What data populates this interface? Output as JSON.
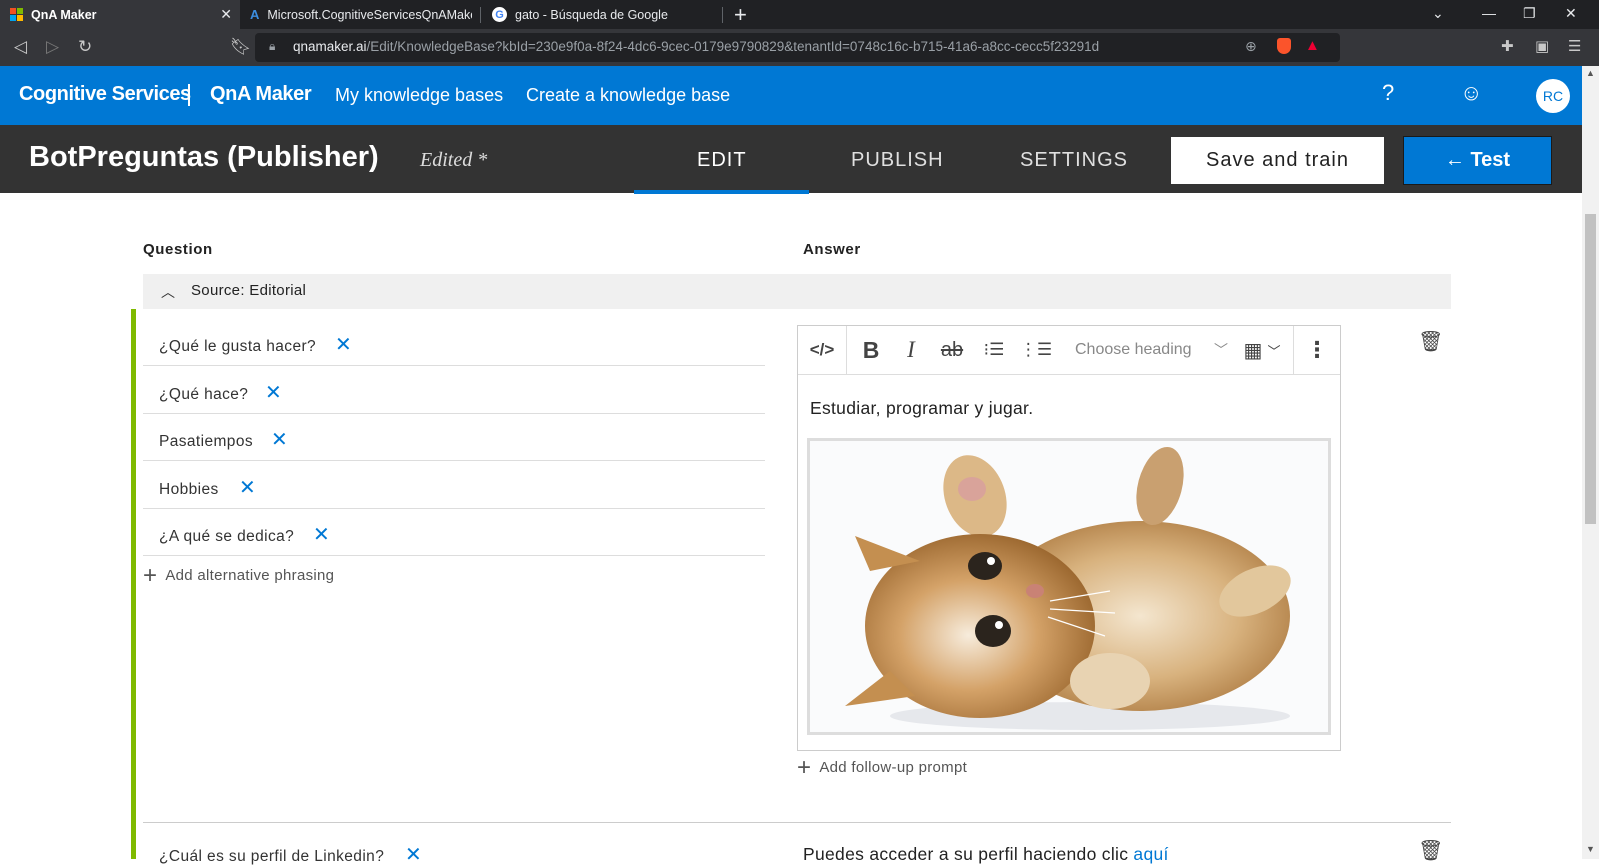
{
  "browser": {
    "tabs": [
      {
        "title": "QnA Maker",
        "active": true
      },
      {
        "title": "Microsoft.CognitiveServicesQnAMaker",
        "active": false
      },
      {
        "title": "gato - Búsqueda de Google",
        "active": false
      }
    ],
    "url_host": "qnamaker.ai",
    "url_path": "/Edit/KnowledgeBase?kbId=230e9f0a-8f24-4dc6-9cec-0179e9790829&tenantId=0748c16c-b715-41a6-a8cc-cecc5f23291d"
  },
  "header": {
    "brand": "Cognitive Services",
    "product": "QnA Maker",
    "nav": [
      "My knowledge bases",
      "Create a knowledge base"
    ],
    "avatar_initials": "RC"
  },
  "kb": {
    "name": "BotPreguntas (Publisher)",
    "status": "Edited *",
    "tabs": [
      "EDIT",
      "PUBLISH",
      "SETTINGS"
    ],
    "active_tab": "EDIT",
    "save_label": "Save and train",
    "test_label": "← Test"
  },
  "columns": {
    "question": "Question",
    "answer": "Answer"
  },
  "source": {
    "label": "Source: Editorial"
  },
  "qna1": {
    "questions": [
      "¿Qué le gusta hacer?",
      "¿Qué hace?",
      "Pasatiempos",
      "Hobbies",
      "¿A qué se dedica?"
    ],
    "add_alt_label": "Add alternative phrasing",
    "editor": {
      "heading_placeholder": "Choose heading"
    },
    "answer_text": "Estudiar, programar y jugar.",
    "add_followup_label": "Add follow-up prompt"
  },
  "qna2": {
    "question": "¿Cuál es su perfil de Linkedin?",
    "answer_text": "Puedes acceder a su perfil haciendo clic ",
    "answer_link": "aquí"
  },
  "colors": {
    "accent": "#0078d4",
    "dark_bar": "#333333",
    "source_accent": "#7fba00"
  }
}
